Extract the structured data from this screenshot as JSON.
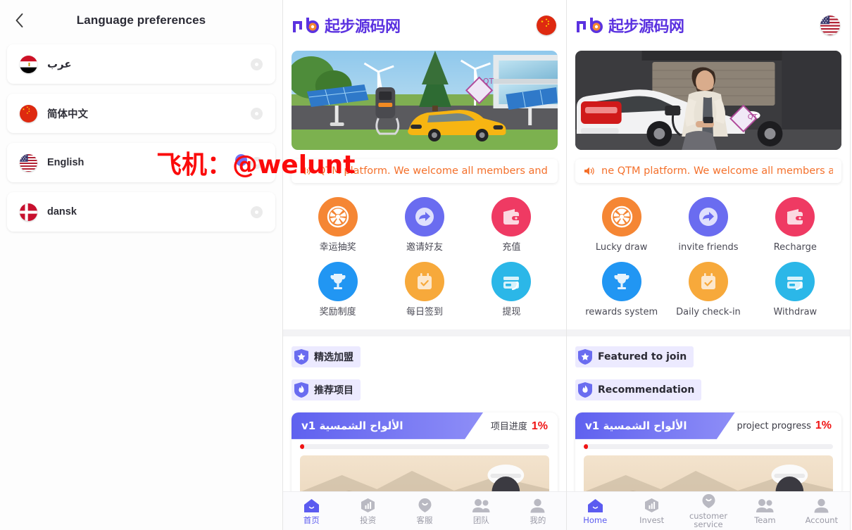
{
  "language_page": {
    "title": "Language preferences",
    "back_icon": "chevron-left-icon",
    "items": [
      {
        "label": "عرب",
        "flag": "eg",
        "selected": false
      },
      {
        "label": "简体中文",
        "flag": "cn",
        "selected": false
      },
      {
        "label": "English",
        "flag": "us",
        "selected": false
      },
      {
        "label": "dansk",
        "flag": "dk",
        "selected": false
      }
    ]
  },
  "watermark": {
    "prefix": "飞机：",
    "at": "@",
    "handle": "welunt",
    "color": "#fb0b0b"
  },
  "brand": {
    "mark": "qb",
    "name": "起步源码网",
    "mark_color": "#5b32e0",
    "accent_color": "#f5872e"
  },
  "app_cn": {
    "flag": "cn",
    "notice": "QTM platform. We welcome all members and in",
    "notice_icon": "speaker-icon",
    "banner": "solar-ev-charging-banner",
    "grid": [
      {
        "label": "幸运抽奖",
        "icon": "lucky-wheel-icon",
        "color": "#f58634"
      },
      {
        "label": "邀请好友",
        "icon": "share-arrow-icon",
        "color": "#6a6cf0"
      },
      {
        "label": "充值",
        "icon": "wallet-icon",
        "color": "#ef3a63"
      },
      {
        "label": "奖励制度",
        "icon": "trophy-icon",
        "color": "#2196f3"
      },
      {
        "label": "每日签到",
        "icon": "calendar-check-icon",
        "color": "#f7a93b"
      },
      {
        "label": "提现",
        "icon": "withdraw-card-icon",
        "color": "#2bb7e8"
      }
    ],
    "tags": [
      {
        "label": "精选加盟",
        "icon": "star-shield-icon"
      },
      {
        "label": "推荐项目",
        "icon": "flame-shield-icon"
      }
    ],
    "project": {
      "name": "الألواح الشمسية v1",
      "progress_label": "项目进度",
      "progress_value": "1%"
    },
    "tabs": [
      {
        "label": "首页",
        "icon": "home-icon",
        "active": true
      },
      {
        "label": "投资",
        "icon": "invest-icon",
        "active": false
      },
      {
        "label": "客服",
        "icon": "support-icon",
        "active": false
      },
      {
        "label": "团队",
        "icon": "team-icon",
        "active": false
      },
      {
        "label": "我的",
        "icon": "account-icon",
        "active": false
      }
    ]
  },
  "app_en": {
    "flag": "us",
    "notice": "ne QTM platform. We welcome all members and",
    "notice_icon": "speaker-icon",
    "banner": "man-charging-white-suv-banner",
    "grid": [
      {
        "label": "Lucky draw",
        "icon": "lucky-wheel-icon",
        "color": "#f58634"
      },
      {
        "label": "invite friends",
        "icon": "share-arrow-icon",
        "color": "#6a6cf0"
      },
      {
        "label": "Recharge",
        "icon": "wallet-icon",
        "color": "#ef3a63"
      },
      {
        "label": "rewards system",
        "icon": "trophy-icon",
        "color": "#2196f3"
      },
      {
        "label": "Daily check-in",
        "icon": "calendar-check-icon",
        "color": "#f7a93b"
      },
      {
        "label": "Withdraw",
        "icon": "withdraw-card-icon",
        "color": "#2bb7e8"
      }
    ],
    "tags": [
      {
        "label": "Featured to join",
        "icon": "star-shield-icon"
      },
      {
        "label": "Recommendation",
        "icon": "flame-shield-icon"
      }
    ],
    "project": {
      "name": "الألواح الشمسية v1",
      "progress_label": "project progress",
      "progress_value": "1%"
    },
    "tabs": [
      {
        "label": "Home",
        "icon": "home-icon",
        "active": true
      },
      {
        "label": "Invest",
        "icon": "invest-icon",
        "active": false
      },
      {
        "label": "customer service",
        "icon": "support-icon",
        "active": false
      },
      {
        "label": "Team",
        "icon": "team-icon",
        "active": false
      },
      {
        "label": "Account",
        "icon": "account-icon",
        "active": false
      }
    ]
  }
}
